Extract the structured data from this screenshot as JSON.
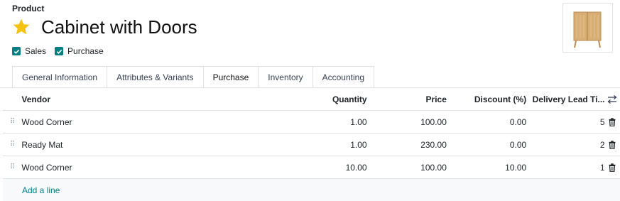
{
  "product_label": "Product",
  "product_name": "Cabinet with Doors",
  "flags": {
    "sales": "Sales",
    "purchase": "Purchase"
  },
  "tabs": [
    "General Information",
    "Attributes & Variants",
    "Purchase",
    "Inventory",
    "Accounting"
  ],
  "active_tab": "Purchase",
  "table": {
    "headers": {
      "vendor": "Vendor",
      "quantity": "Quantity",
      "price": "Price",
      "discount": "Discount (%)",
      "lead": "Delivery Lead Ti..."
    },
    "rows": [
      {
        "vendor": "Wood Corner",
        "quantity": "1.00",
        "price": "100.00",
        "discount": "0.00",
        "lead": "5"
      },
      {
        "vendor": "Ready Mat",
        "quantity": "1.00",
        "price": "230.00",
        "discount": "0.00",
        "lead": "2"
      },
      {
        "vendor": "Wood Corner",
        "quantity": "10.00",
        "price": "100.00",
        "discount": "10.00",
        "lead": "1"
      }
    ],
    "add_line": "Add a line"
  },
  "colors": {
    "accent": "#017e84",
    "star": "#f3c30f"
  }
}
